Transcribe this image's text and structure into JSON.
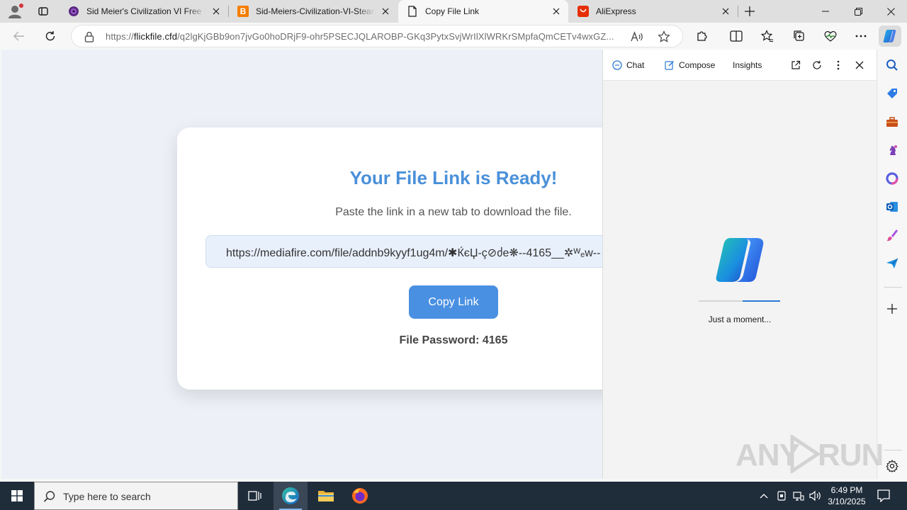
{
  "browser": {
    "tabs": [
      {
        "title": "Sid Meier's Civilization VI Free Do",
        "favicon": "civ-logo-icon",
        "active": false
      },
      {
        "title": "Sid-Meiers-Civilization-VI-Steam",
        "favicon": "blogger-icon",
        "favicon_letter": "B",
        "active": false
      },
      {
        "title": "Copy File Link",
        "favicon": "page-icon",
        "active": true
      },
      {
        "title": "AliExpress",
        "favicon": "aliexpress-icon",
        "active": false
      }
    ],
    "address": {
      "scheme": "https://",
      "host": "flickfile.cfd",
      "path": "/q2lgKjGBb9on7jvGo0hoDRjF9-ohr5PSECJQLAROBP-GKq3PytxSvjWrIlXlWRKrSMpfaQmCETv4wxGZ..."
    },
    "colors": {
      "accent": "#4a90e2",
      "tabstrip": "#dfdfdf",
      "copilot_blue": "#2a7ad5"
    }
  },
  "page": {
    "heading": "Your File Link is Ready!",
    "subtitle": "Paste the link in a new tab to download the file.",
    "link": "https://mediafire.com/file/addnb9kyyf1ug4m/✱ЌєЏ-ç⊘ძe❋--4165__✲ᵂₑw--",
    "copy_button_label": "Copy Link",
    "password_label": "File Password: 4165"
  },
  "sidepanel": {
    "tabs": {
      "chat": "Chat",
      "compose": "Compose",
      "insights": "Insights"
    },
    "loading_text": "Just a moment..."
  },
  "watermark": {
    "left": "ANY",
    "right": "RUN"
  },
  "taskbar": {
    "search_placeholder": "Type here to search",
    "time": "6:49 PM",
    "date": "3/10/2025"
  }
}
